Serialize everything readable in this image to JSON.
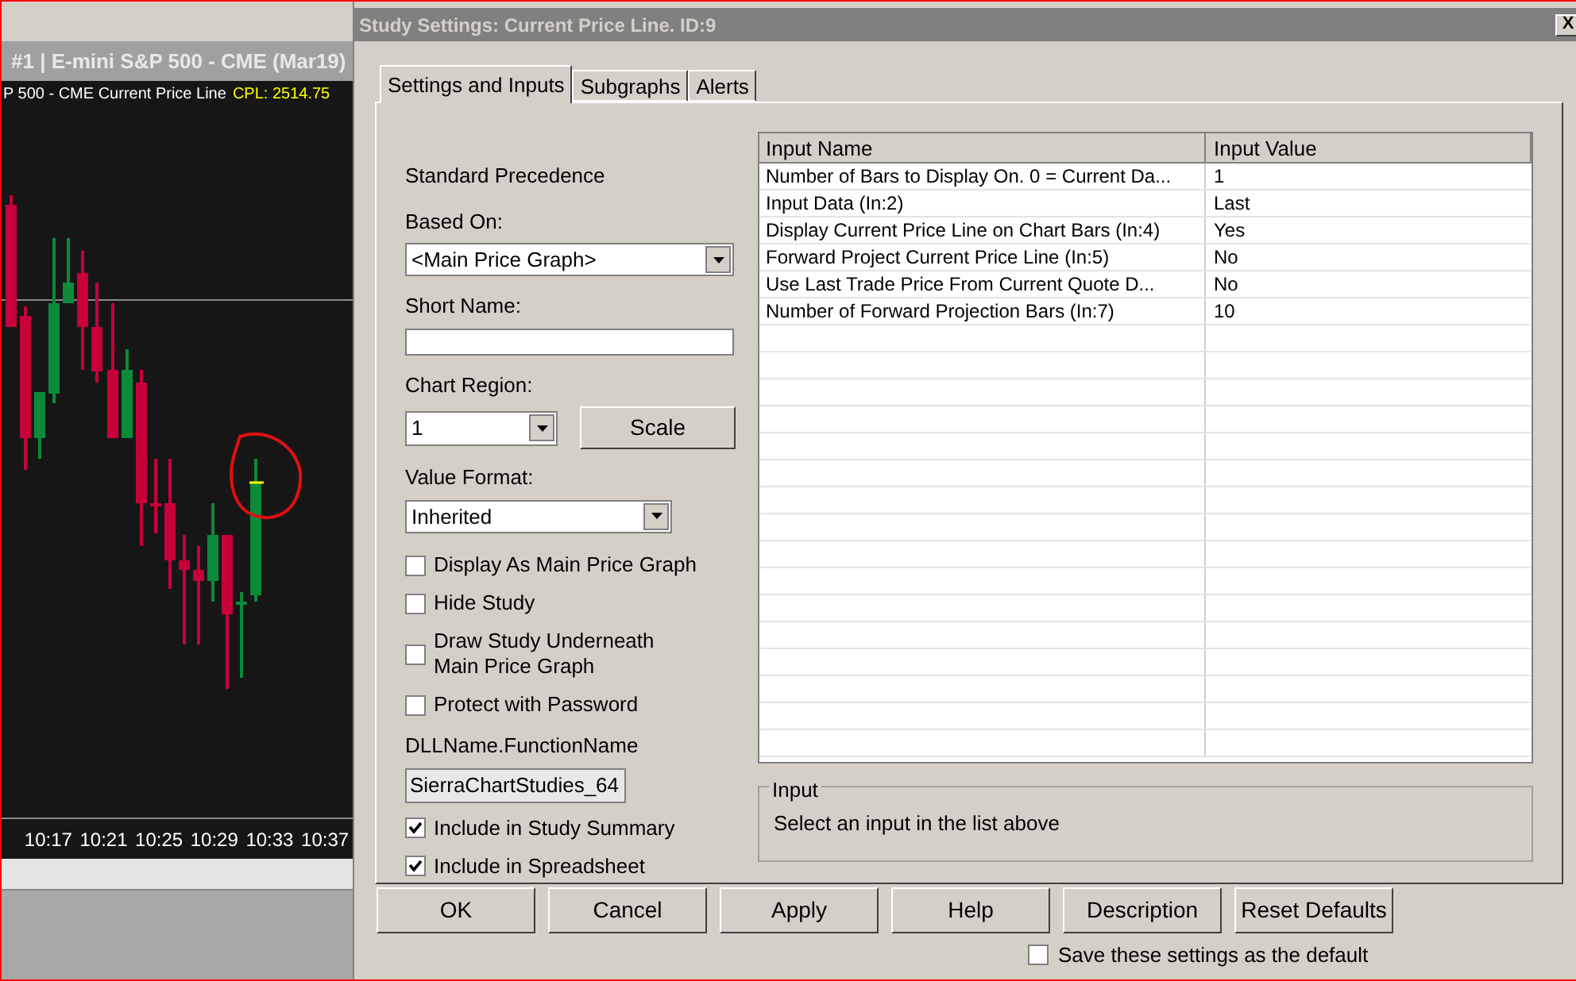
{
  "chart_window": {
    "title": "#1 | E-mini S&P 500 - CME (Mar19)",
    "study_label": "P 500 - CME Current Price Line",
    "price_label": "CPL: 2514.75",
    "time_labels": [
      "10:17",
      "10:21",
      "10:25",
      "10:29",
      "10:33",
      "10:37"
    ]
  },
  "dialog": {
    "title": "Study Settings: Current Price Line. ID:9",
    "close": "X",
    "tabs": [
      {
        "label": "Settings and Inputs",
        "selected": true
      },
      {
        "label": "Subgraphs",
        "selected": false
      },
      {
        "label": "Alerts",
        "selected": false
      }
    ],
    "standard_precedence": "Standard Precedence",
    "based_on": {
      "label": "Based On:",
      "value": "<Main Price Graph>"
    },
    "short_name": {
      "label": "Short Name:"
    },
    "chart_region": {
      "label": "Chart Region:",
      "value": "1",
      "scale_button": "Scale"
    },
    "value_format": {
      "label": "Value Format:",
      "value": "Inherited"
    },
    "options": [
      {
        "label": "Display As Main Price Graph",
        "checked": false
      },
      {
        "label": "Hide Study",
        "checked": false
      },
      {
        "label": "Draw Study Underneath Main Price Graph",
        "checked": false
      },
      {
        "label": "Protect with Password",
        "checked": false
      }
    ],
    "dll": {
      "label": "DLLName.FunctionName",
      "value": "SierraChartStudies_64"
    },
    "options_2": [
      {
        "label": "Include in Study Summary",
        "checked": true
      },
      {
        "label": "Include in Spreadsheet",
        "checked": true
      }
    ],
    "table": {
      "columns": [
        "Input Name",
        "Input Value"
      ],
      "rows": [
        {
          "name": "Number of Bars to Display On. 0 = Current Da...",
          "value": "1"
        },
        {
          "name": "Input Data   (In:2)",
          "value": "Last"
        },
        {
          "name": "Display Current Price Line on Chart Bars   (In:4)",
          "value": "Yes"
        },
        {
          "name": "Forward Project Current Price Line   (In:5)",
          "value": "No"
        },
        {
          "name": "Use Last Trade Price From Current Quote D...",
          "value": "No"
        },
        {
          "name": "Number of Forward Projection Bars   (In:7)",
          "value": "10"
        }
      ]
    },
    "input_group": {
      "legend": "Input",
      "text": "Select an input in the list above"
    },
    "buttons": [
      "OK",
      "Cancel",
      "Apply",
      "Help",
      "Description",
      "Reset Defaults"
    ],
    "save_default": {
      "label": "Save these settings as the default",
      "checked": false
    }
  }
}
